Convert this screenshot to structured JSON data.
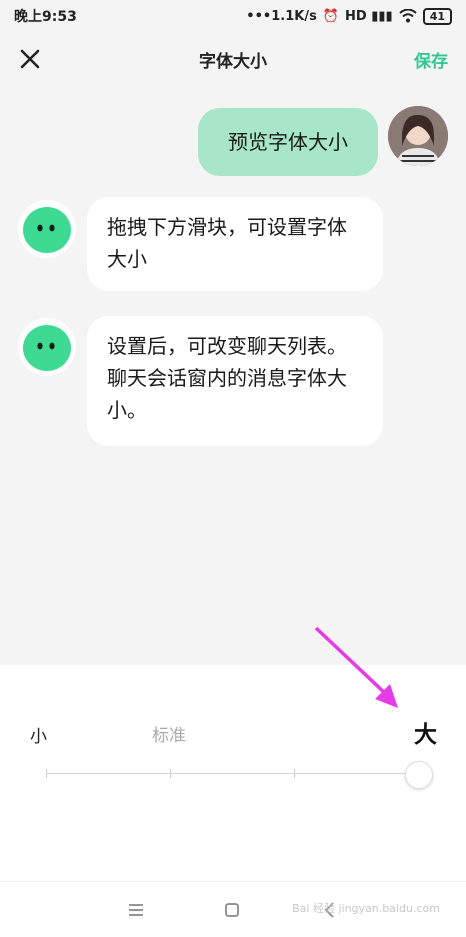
{
  "status_bar": {
    "time": "晚上9:53",
    "network_speed": "•••1.1K/s",
    "alarm_icon": "alarm-clock-icon",
    "signal": "HD ▮▮▮",
    "wifi_icon": "wifi-icon",
    "battery": "41"
  },
  "header": {
    "title": "字体大小",
    "save_label": "保存",
    "close_icon": "close-icon"
  },
  "preview": {
    "user_message": "预览字体大小",
    "bot_messages": [
      "拖拽下方滑块，可设置字体大小",
      "设置后，可改变聊天列表。聊天会话窗内的消息字体大小。"
    ]
  },
  "font_size_panel": {
    "labels": [
      "小",
      "标准",
      "大"
    ],
    "selected": "大",
    "slider_positions": 4,
    "selected_index": 3
  },
  "nav_bar": {
    "buttons": [
      "menu-icon",
      "home-icon",
      "back-icon"
    ],
    "watermark": "Bai 经验 jingyan.baidu.com"
  },
  "colors": {
    "accent": "#33c790",
    "user_bubble": "#a7e6c8",
    "bot_avatar": "#3ed993",
    "annotation_arrow": "#e63be6"
  }
}
